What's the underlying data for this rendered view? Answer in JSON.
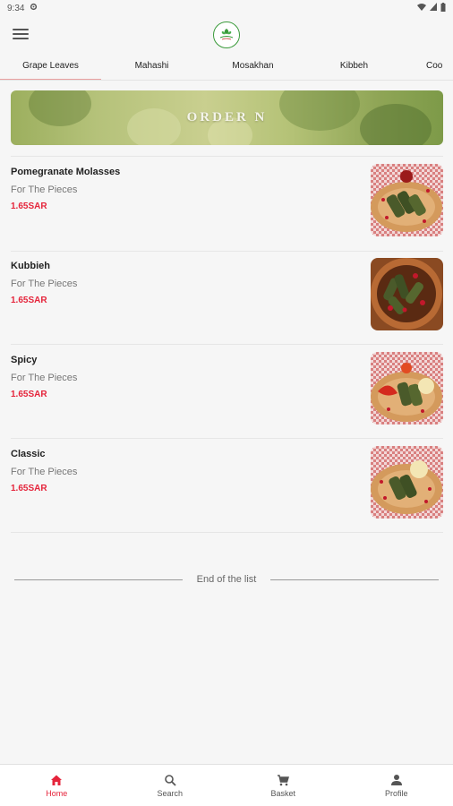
{
  "status": {
    "time": "9:34"
  },
  "tabs": [
    {
      "label": "Grape Leaves",
      "active": true
    },
    {
      "label": "Mahashi",
      "active": false
    },
    {
      "label": "Mosakhan",
      "active": false
    },
    {
      "label": "Kibbeh",
      "active": false
    },
    {
      "label": "Coo",
      "active": false
    }
  ],
  "banner": {
    "text": "ORDER N"
  },
  "products": [
    {
      "name": "Pomegranate Molasses",
      "subtitle": "For The Pieces",
      "price": "1.65SAR",
      "image": "grape-leaves-plate"
    },
    {
      "name": "Kubbieh",
      "subtitle": "For The Pieces",
      "price": "1.65SAR",
      "image": "grape-leaves-pot"
    },
    {
      "name": "Spicy",
      "subtitle": "For The Pieces",
      "price": "1.65SAR",
      "image": "grape-leaves-plate"
    },
    {
      "name": "Classic",
      "subtitle": "For The Pieces",
      "price": "1.65SAR",
      "image": "grape-leaves-plate"
    }
  ],
  "end_of_list": "End of the list",
  "bottom_nav": [
    {
      "label": "Home",
      "icon": "home-icon",
      "active": true
    },
    {
      "label": "Search",
      "icon": "search-icon",
      "active": false
    },
    {
      "label": "Basket",
      "icon": "cart-icon",
      "active": false
    },
    {
      "label": "Profile",
      "icon": "person-icon",
      "active": false
    }
  ],
  "colors": {
    "accent": "#e5243b",
    "price": "#e5243b",
    "tab_indicator": "#e8a0a0"
  }
}
